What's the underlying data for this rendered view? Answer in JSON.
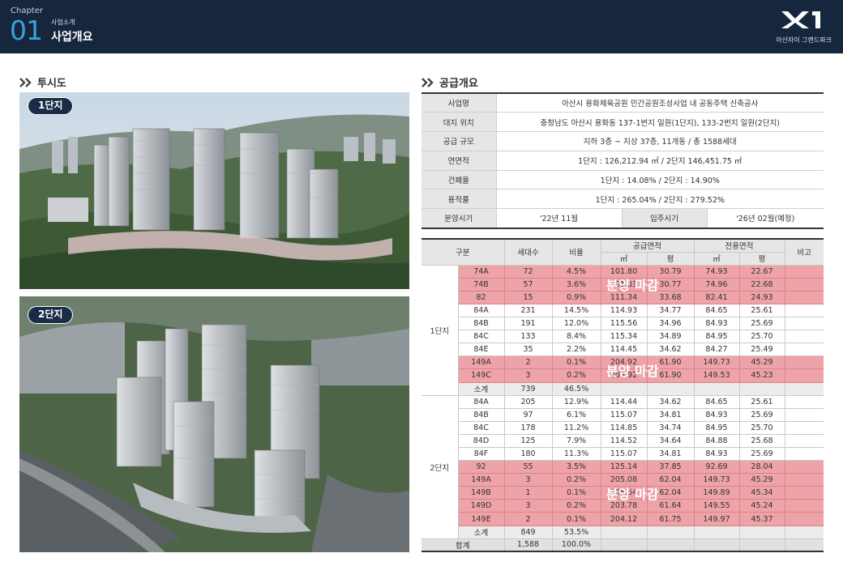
{
  "header": {
    "chapter_label": "Chapter",
    "chapter_number": "01",
    "sub_label": "사업소개",
    "title": "사업개요",
    "brand": "아산자이 그랜드파크",
    "logo_icon": "xi-logo-icon"
  },
  "sections": {
    "perspective": "투시도",
    "overview": "공급개요"
  },
  "photos": [
    {
      "badge": "1단지"
    },
    {
      "badge": "2단지"
    }
  ],
  "overview": {
    "rows": [
      {
        "label": "사업명",
        "value": "아산시 용화체육공원 민간공원조성사업 내 공동주택 신축공사"
      },
      {
        "label": "대지 위치",
        "value": "충청남도 아산시 용화동 137-1번지 일원(1단지), 133-2번지 일원(2단지)"
      },
      {
        "label": "공급 규모",
        "value": "지하 3층 ~ 지상 37층, 11개동 / 총 1588세대"
      },
      {
        "label": "연면적",
        "value": "1단지 : 126,212.94 ㎡ / 2단지 146,451.75 ㎡"
      },
      {
        "label": "건폐율",
        "value": "1단지 : 14.08% / 2단지 : 14.90%"
      },
      {
        "label": "용적률",
        "value": "1단지 : 265.04% / 2단지 : 279.52%"
      }
    ],
    "sale_label": "분양시기",
    "sale_value": "'22년 11월",
    "move_label": "입주시기",
    "move_value": "'26년 02월(예정)"
  },
  "units": {
    "headers": {
      "group": "구분",
      "households": "세대수",
      "ratio": "비율",
      "supply": "공급면적",
      "exclusive": "전용면적",
      "note": "비고",
      "sqm": "㎡",
      "pyeong": "평"
    },
    "sold_out_label": "분양 마감",
    "complex1": {
      "name": "1단지",
      "rows": [
        {
          "type": "74A",
          "hh": "72",
          "ratio": "4.5%",
          "s_m2": "101.80",
          "s_py": "30.79",
          "e_m2": "74.93",
          "e_py": "22.67",
          "sold": true
        },
        {
          "type": "74B",
          "hh": "57",
          "ratio": "3.6%",
          "s_m2": "101.83",
          "s_py": "30.77",
          "e_m2": "74.96",
          "e_py": "22.68",
          "sold": true
        },
        {
          "type": "82",
          "hh": "15",
          "ratio": "0.9%",
          "s_m2": "111.34",
          "s_py": "33.68",
          "e_m2": "82.41",
          "e_py": "24.93",
          "sold": true
        },
        {
          "type": "84A",
          "hh": "231",
          "ratio": "14.5%",
          "s_m2": "114.93",
          "s_py": "34.77",
          "e_m2": "84.65",
          "e_py": "25.61",
          "sold": false
        },
        {
          "type": "84B",
          "hh": "191",
          "ratio": "12.0%",
          "s_m2": "115.56",
          "s_py": "34.96",
          "e_m2": "84.93",
          "e_py": "25.69",
          "sold": false
        },
        {
          "type": "84C",
          "hh": "133",
          "ratio": "8.4%",
          "s_m2": "115.34",
          "s_py": "34.89",
          "e_m2": "84.95",
          "e_py": "25.70",
          "sold": false
        },
        {
          "type": "84E",
          "hh": "35",
          "ratio": "2.2%",
          "s_m2": "114.45",
          "s_py": "34.62",
          "e_m2": "84.27",
          "e_py": "25.49",
          "sold": false
        },
        {
          "type": "149A",
          "hh": "2",
          "ratio": "0.1%",
          "s_m2": "204.92",
          "s_py": "61.90",
          "e_m2": "149.73",
          "e_py": "45.29",
          "sold": true
        },
        {
          "type": "149C",
          "hh": "3",
          "ratio": "0.2%",
          "s_m2": "204.92",
          "s_py": "61.90",
          "e_m2": "149.53",
          "e_py": "45.23",
          "sold": true
        }
      ],
      "subtotal": {
        "label": "소계",
        "hh": "739",
        "ratio": "46.5%"
      }
    },
    "complex2": {
      "name": "2단지",
      "rows": [
        {
          "type": "84A",
          "hh": "205",
          "ratio": "12.9%",
          "s_m2": "114.44",
          "s_py": "34.62",
          "e_m2": "84.65",
          "e_py": "25.61",
          "sold": false
        },
        {
          "type": "84B",
          "hh": "97",
          "ratio": "6.1%",
          "s_m2": "115.07",
          "s_py": "34.81",
          "e_m2": "84.93",
          "e_py": "25.69",
          "sold": false
        },
        {
          "type": "84C",
          "hh": "178",
          "ratio": "11.2%",
          "s_m2": "114.85",
          "s_py": "34.74",
          "e_m2": "84.95",
          "e_py": "25.70",
          "sold": false
        },
        {
          "type": "84D",
          "hh": "125",
          "ratio": "7.9%",
          "s_m2": "114.52",
          "s_py": "34.64",
          "e_m2": "84.88",
          "e_py": "25.68",
          "sold": false
        },
        {
          "type": "84F",
          "hh": "180",
          "ratio": "11.3%",
          "s_m2": "115.07",
          "s_py": "34.81",
          "e_m2": "84.93",
          "e_py": "25.69",
          "sold": false
        },
        {
          "type": "92",
          "hh": "55",
          "ratio": "3.5%",
          "s_m2": "125.14",
          "s_py": "37.85",
          "e_m2": "92.69",
          "e_py": "28.04",
          "sold": true
        },
        {
          "type": "149A",
          "hh": "3",
          "ratio": "0.2%",
          "s_m2": "205.08",
          "s_py": "62.04",
          "e_m2": "149.73",
          "e_py": "45.29",
          "sold": true
        },
        {
          "type": "149B",
          "hh": "1",
          "ratio": "0.1%",
          "s_m2": "205.64",
          "s_py": "62.04",
          "e_m2": "149.89",
          "e_py": "45.34",
          "sold": true
        },
        {
          "type": "149D",
          "hh": "3",
          "ratio": "0.2%",
          "s_m2": "203.78",
          "s_py": "61.64",
          "e_m2": "149.55",
          "e_py": "45.24",
          "sold": true
        },
        {
          "type": "149E",
          "hh": "2",
          "ratio": "0.1%",
          "s_m2": "204.12",
          "s_py": "61.75",
          "e_m2": "149.97",
          "e_py": "45.37",
          "sold": true
        }
      ],
      "subtotal": {
        "label": "소계",
        "hh": "849",
        "ratio": "53.5%"
      }
    },
    "total": {
      "label": "합계",
      "hh": "1,588",
      "ratio": "100.0%"
    }
  }
}
